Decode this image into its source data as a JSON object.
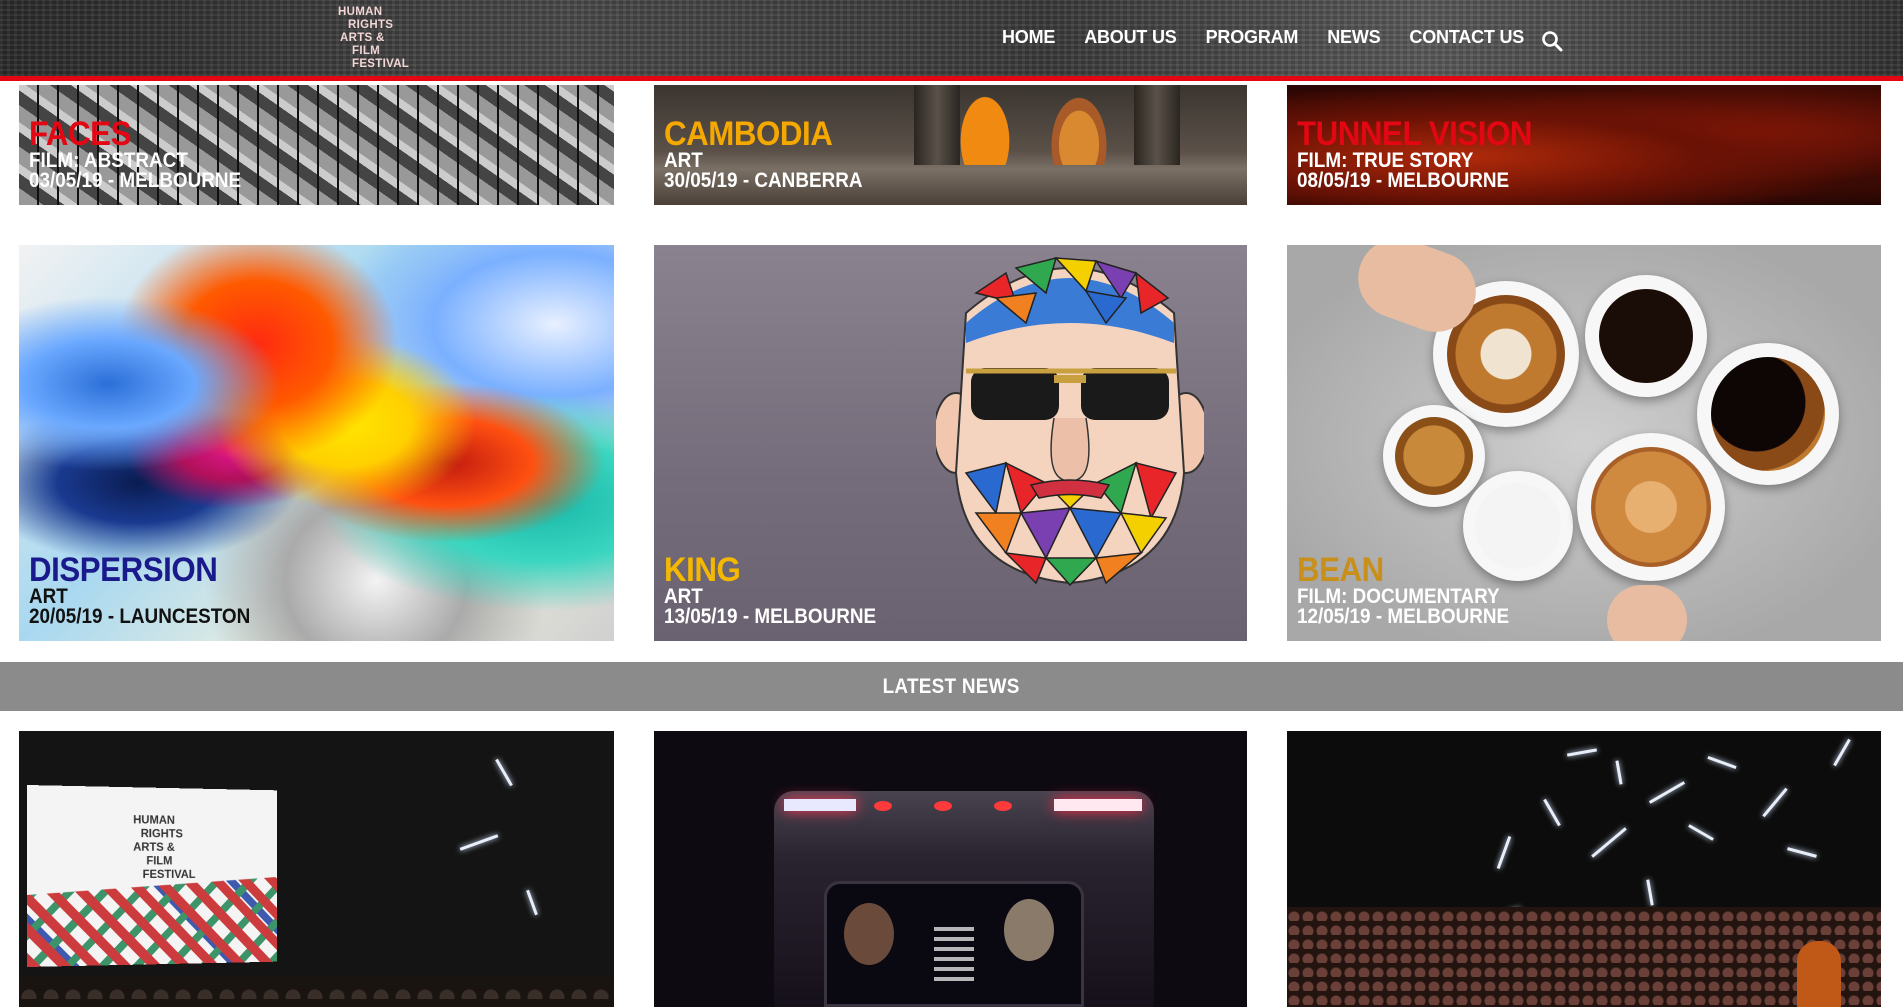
{
  "header": {
    "logo_lines": [
      "HUMAN",
      "RIGHTS",
      "ARTS &",
      "FILM",
      "FESTIVAL"
    ],
    "nav": [
      "HOME",
      "ABOUT US",
      "PROGRAM",
      "NEWS",
      "CONTACT US"
    ],
    "search_icon": "search-icon",
    "accent_color": "#e30613"
  },
  "events": [
    {
      "title": "FACES",
      "category": "FILM: ABSTRACT",
      "date_location": "03/05/19 - MELBOURNE",
      "title_color": "#e30613"
    },
    {
      "title": "CAMBODIA",
      "category": "ART",
      "date_location": "30/05/19 - CANBERRA",
      "title_color": "#f5a800"
    },
    {
      "title": "TUNNEL VISION",
      "category": "FILM: TRUE STORY",
      "date_location": "08/05/19 - MELBOURNE",
      "title_color": "#e30613"
    },
    {
      "title": "DISPERSION",
      "category": "ART",
      "date_location": "20/05/19 - LAUNCESTON",
      "title_color": "#1a1a8c"
    },
    {
      "title": "KING",
      "category": "ART",
      "date_location": "13/05/19 - MELBOURNE",
      "title_color": "#f5b800"
    },
    {
      "title": "BEAN",
      "category": "FILM: DOCUMENTARY",
      "date_location": "12/05/19 - MELBOURNE",
      "title_color": "#c8901a"
    }
  ],
  "latest_news": {
    "heading": "LATEST NEWS"
  },
  "news_screen": {
    "lines": [
      "HUMAN",
      "RIGHTS",
      "ARTS &",
      "FILM",
      "FESTIVAL"
    ]
  }
}
